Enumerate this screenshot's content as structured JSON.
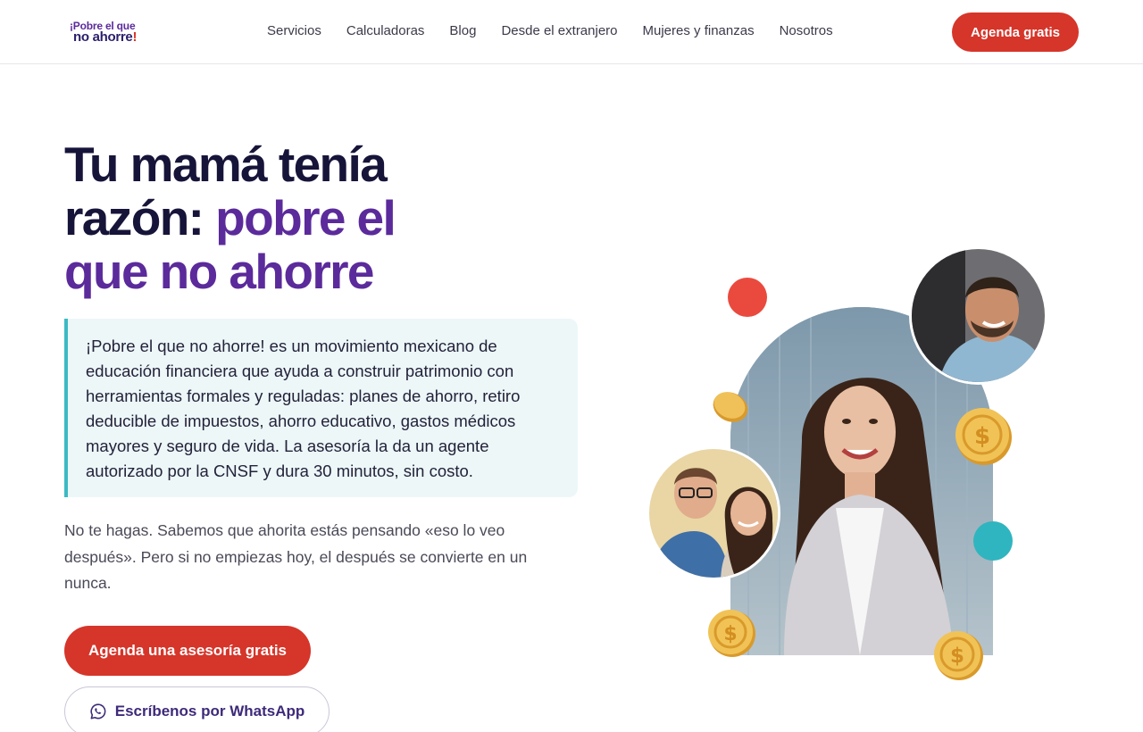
{
  "header": {
    "logo": {
      "line1": "¡Pobre el que",
      "line2": "no ahorre",
      "line2_bang": "!"
    },
    "nav": [
      {
        "label": "Servicios"
      },
      {
        "label": "Calculadoras"
      },
      {
        "label": "Blog"
      },
      {
        "label": "Desde el extranjero"
      },
      {
        "label": "Mujeres y finanzas"
      },
      {
        "label": "Nosotros"
      }
    ],
    "cta_label": "Agenda gratis"
  },
  "hero": {
    "title_part1": "Tu mamá tenía razón: ",
    "title_accent": "pobre el que no ahorre",
    "intro": "¡Pobre el que no ahorre! es un movimiento mexicano de educación financiera que ayuda a construir patrimonio con herramientas formales y reguladas: planes de ahorro, retiro deducible de impuestos, ahorro educativo, gastos médicos mayores y seguro de vida. La asesoría la da un agente autorizado por la CNSF y dura 30 minutos, sin costo.",
    "subtext": "No te hagas. Sabemos que ahorita estás pensando «eso lo veo después». Pero si no empiezas hoy, el después se convierte en un nunca.",
    "primary_cta": "Agenda una asesoría gratis",
    "whatsapp_cta": "Escríbenos por WhatsApp",
    "whatsapp_icon": "whatsapp-icon"
  },
  "colors": {
    "brand_red": "#d6352a",
    "brand_purple": "#5b2a9b",
    "dark_navy": "#17143a",
    "teal": "#3bbac4",
    "coin_gold": "#e8b64a"
  }
}
